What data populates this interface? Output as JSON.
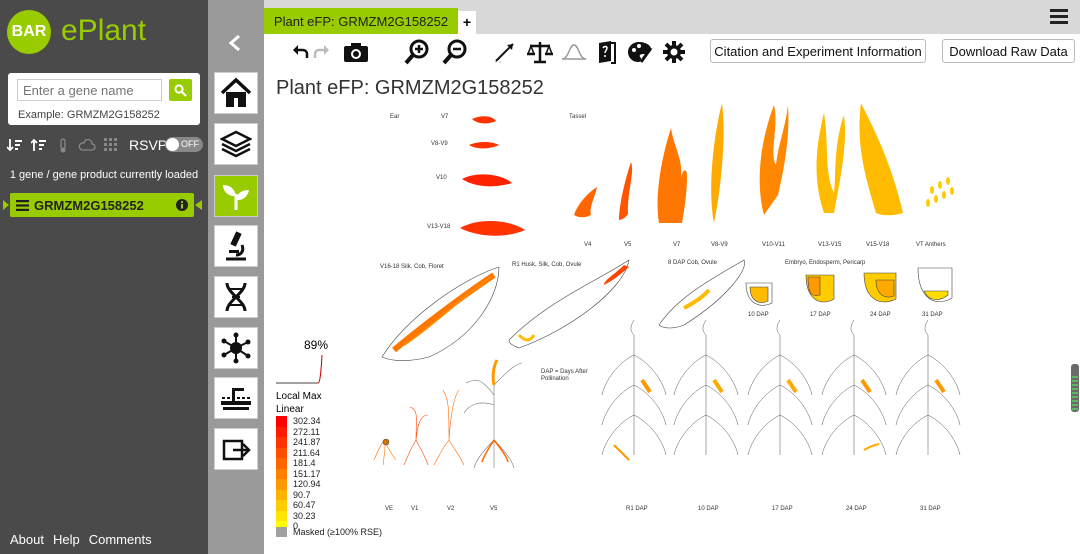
{
  "app": {
    "logo_text": "BAR",
    "name": "ePlant"
  },
  "search": {
    "placeholder": "Enter a gene name",
    "example": "Example: GRMZM2G158252"
  },
  "rsvp": {
    "label": "RSVP",
    "state": "OFF"
  },
  "loaded_count": "1 gene / gene product currently loaded",
  "gene_item": {
    "name": "GRMZM2G158252"
  },
  "footer": {
    "about": "About",
    "help": "Help",
    "comments": "Comments"
  },
  "tab": {
    "title": "Plant eFP: GRMZM2G158252",
    "add": "+"
  },
  "toolbar": {
    "citation": "Citation and Experiment Information",
    "download": "Download Raw Data"
  },
  "view_title": "Plant eFP: GRMZM2G158252",
  "tissue_labels": {
    "ear": "Ear",
    "v7": "V7",
    "v8v9": "V8-V9",
    "v10": "V10",
    "v13v18": "V13-V18",
    "tassel": "Tassel",
    "t_v4": "V4",
    "t_v5": "V5",
    "t_v7": "V7",
    "t_v8v9": "V8-V9",
    "t_v10v11": "V10-V11",
    "t_v13v15": "V13-V15",
    "t_v15v18": "V15-V18",
    "t_vt": "VT Anthers",
    "silk": "V16-18 Silk, Cob, Floret",
    "husk": "R1 Husk, Silk, Cob, Ovule",
    "dap8": "8 DAP Cob, Ovule",
    "embryo": "Embryo, Endosperm, Pericarp",
    "d10": "10 DAP",
    "d17": "17 DAP",
    "d24": "24 DAP",
    "d31": "31 DAP",
    "dap_note1": "DAP = Days After",
    "dap_note2": "Pollination",
    "ve": "VE",
    "v1": "V1",
    "v2": "V2",
    "v5": "V5",
    "r1": "R1 DAP",
    "r10": "10 DAP",
    "r17": "17 DAP",
    "r24": "24 DAP",
    "r31": "31 DAP"
  },
  "legend": {
    "percent": "89%",
    "title1": "Local Max",
    "title2": "Linear",
    "scale": [
      {
        "value": "302.34",
        "color": "#ff0000"
      },
      {
        "value": "272.11",
        "color": "#ff1a00"
      },
      {
        "value": "241.87",
        "color": "#ff3300"
      },
      {
        "value": "211.64",
        "color": "#ff4d00"
      },
      {
        "value": "181.4",
        "color": "#ff6600"
      },
      {
        "value": "151.17",
        "color": "#ff8000"
      },
      {
        "value": "120.94",
        "color": "#ff9900"
      },
      {
        "value": "90.7",
        "color": "#ffb300"
      },
      {
        "value": "60.47",
        "color": "#ffcc00"
      },
      {
        "value": "30.23",
        "color": "#ffe600"
      },
      {
        "value": "0",
        "color": "#ffff00"
      }
    ],
    "masked": "Masked (≥100% RSE)"
  },
  "colors": {
    "accent": "#99cc00",
    "sidebar": "#4a4a4a"
  }
}
